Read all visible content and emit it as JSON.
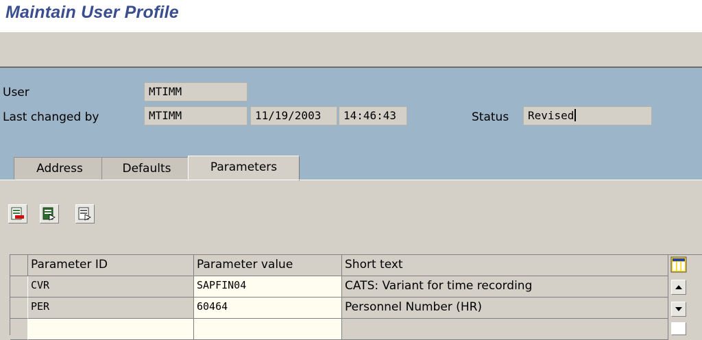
{
  "window": {
    "title": "Maintain User Profile"
  },
  "header": {
    "user_label": "User",
    "user_value": "MTIMM",
    "last_changed_label": "Last changed by",
    "last_changed_value": "MTIMM",
    "date_value": "11/19/2003",
    "time_value": "14:46:43",
    "status_label": "Status",
    "status_value": "Revised"
  },
  "tabs": [
    {
      "label": "Address",
      "active": false
    },
    {
      "label": "Defaults",
      "active": false
    },
    {
      "label": "Parameters",
      "active": true
    }
  ],
  "table_toolbar": {
    "buttons": [
      "delete-row-icon",
      "select-all-icon",
      "deselect-all-icon"
    ]
  },
  "table": {
    "columns": [
      "Parameter ID",
      "Parameter value",
      "Short text"
    ],
    "rows": [
      {
        "id": "CVR",
        "value": "SAPFIN04",
        "text": "CATS: Variant for time recording"
      },
      {
        "id": "PER",
        "value": "60464",
        "text": "Personnel Number (HR)"
      },
      {
        "id": "",
        "value": "",
        "text": ""
      }
    ],
    "settings_icon": "table-settings-icon"
  },
  "colors": {
    "title": "#3a4d8f",
    "header_band": "#9db5c9",
    "panel": "#d4d0c8",
    "input_bg": "#fffdf0"
  }
}
